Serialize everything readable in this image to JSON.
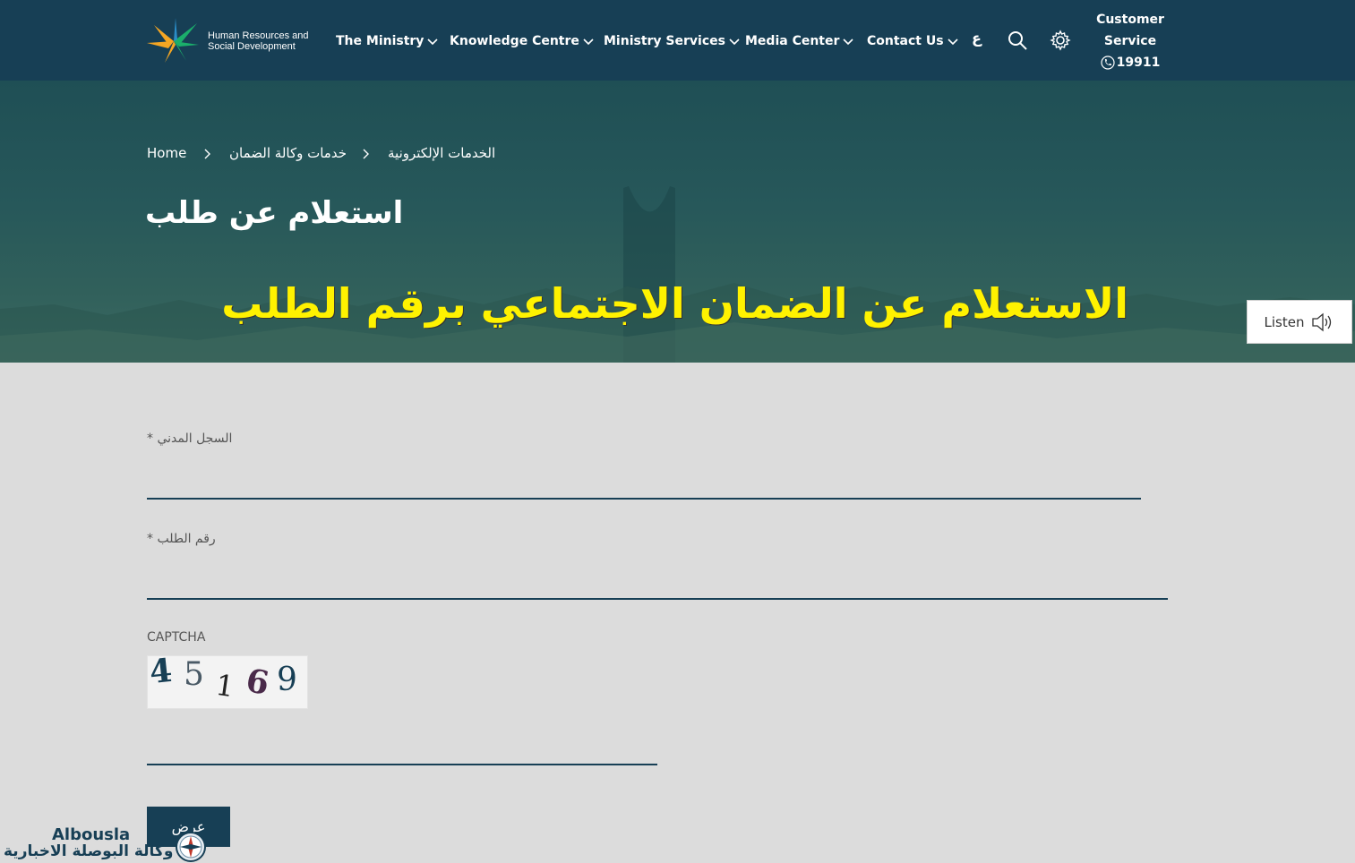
{
  "header": {
    "logo_text_line1": "Human Resources and",
    "logo_text_line2": "Social Development",
    "nav": [
      {
        "label": "The Ministry"
      },
      {
        "label": "Knowledge Centre"
      },
      {
        "label": "Ministry Services"
      },
      {
        "label": "Media Center"
      },
      {
        "label": "Contact Us"
      }
    ],
    "language_toggle": "ع",
    "icons": {
      "search": "search-icon",
      "settings": "gear-icon",
      "phone": "phone-icon"
    },
    "customer_service": {
      "line1": "Customer",
      "line2": "Service",
      "number": "19911"
    }
  },
  "hero": {
    "breadcrumb": [
      "Home",
      "خدمات وكالة الضمان",
      "الخدمات الإلكترونية"
    ],
    "title": "استعلام عن طلب",
    "overlay_caption": "الاستعلام عن الضمان الاجتماعي برقم الطلب"
  },
  "listen": {
    "label": "Listen",
    "icon": "speaker-icon"
  },
  "form": {
    "civil_record": {
      "label": "* السجل المدني",
      "value": ""
    },
    "request_number": {
      "label": "* رقم الطلب",
      "value": ""
    },
    "captcha": {
      "label": "CAPTCHA",
      "chars": [
        "4",
        "5",
        "1",
        "6",
        "9"
      ],
      "value": ""
    },
    "submit_label": "عرض"
  },
  "watermark": {
    "latin": "Albousla",
    "arabic": "وكالة البوصلة الاخبارية"
  },
  "colors": {
    "navy": "#173f55",
    "caption_yellow": "#fff200",
    "form_bg": "#dcdcdc",
    "logo_green": "#1bae6b",
    "logo_orange": "#f5a623",
    "logo_blue": "#2a8dc8"
  }
}
